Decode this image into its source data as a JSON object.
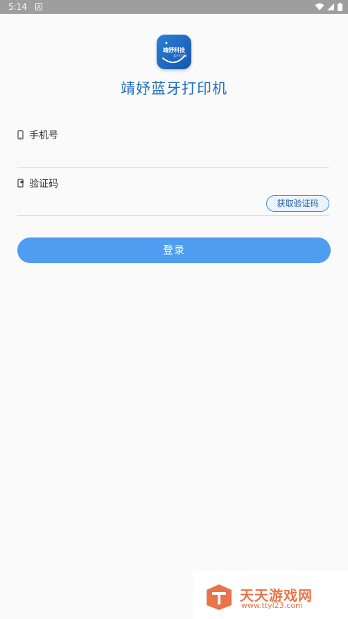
{
  "status_bar": {
    "time": "5:14",
    "notification_icon": "a-box-icon",
    "icons": [
      "wifi-icon",
      "signal-icon",
      "battery-icon"
    ]
  },
  "logo": {
    "text": "靖妤科技",
    "subtext": "蓝牙打印机"
  },
  "app_title": "靖妤蓝牙打印机",
  "phone_field": {
    "label": "手机号",
    "icon": "phone-icon",
    "value": ""
  },
  "code_field": {
    "label": "验证码",
    "icon": "sms-icon",
    "value": "",
    "get_code_label": "获取验证码"
  },
  "login_button": {
    "label": "登录"
  },
  "watermark": {
    "title": "天天游戏网",
    "url": "www.ttyl23.com"
  },
  "colors": {
    "accent": "#4e9df0",
    "title": "#1e6fc0",
    "watermark": "#e8744a"
  }
}
